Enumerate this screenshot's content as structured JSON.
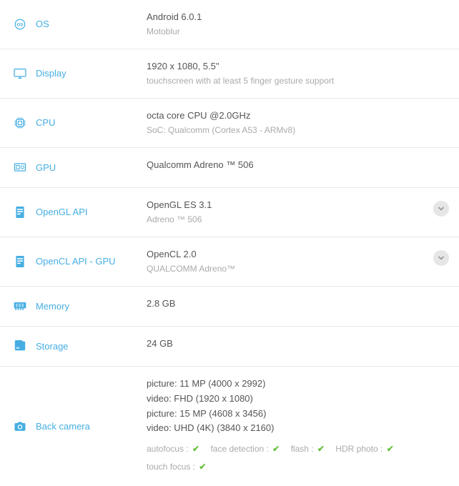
{
  "specs": [
    {
      "icon": "os",
      "label": "OS",
      "primary": "Android 6.0.1",
      "secondary": "Motoblur",
      "expandable": false
    },
    {
      "icon": "display",
      "label": "Display",
      "primary": "1920 x 1080, 5.5\"",
      "secondary": "touchscreen with at least 5 finger gesture support",
      "expandable": false
    },
    {
      "icon": "cpu",
      "label": "CPU",
      "primary": "octa core CPU @2.0GHz",
      "secondary": "SoC: Qualcomm (Cortex A53 - ARMv8)",
      "expandable": false
    },
    {
      "icon": "gpu",
      "label": "GPU",
      "primary": "Qualcomm Adreno ™ 506",
      "secondary": null,
      "expandable": false
    },
    {
      "icon": "opengl",
      "label": "OpenGL API",
      "primary": "OpenGL ES 3.1",
      "secondary": "Adreno ™ 506",
      "expandable": true
    },
    {
      "icon": "opencl",
      "label": "OpenCL API - GPU",
      "primary": "OpenCL 2.0",
      "secondary": "QUALCOMM Adreno™",
      "expandable": true
    },
    {
      "icon": "memory",
      "label": "Memory",
      "primary": "2.8 GB",
      "secondary": null,
      "expandable": false
    },
    {
      "icon": "storage",
      "label": "Storage",
      "primary": "24 GB",
      "secondary": null,
      "expandable": false
    },
    {
      "icon": "camera",
      "label": "Back camera",
      "lines": [
        "picture: 11 MP (4000 x 2992)",
        "video: FHD (1920 x 1080)",
        "picture: 15 MP (4608 x 3456)",
        "video: UHD (4K) (3840 x 2160)"
      ],
      "features": [
        "autofocus :",
        "face detection :",
        "flash :",
        "HDR photo :",
        "touch focus :"
      ],
      "expandable": false
    }
  ],
  "icon_color": "#46aee2",
  "check_color": "#6abf40"
}
